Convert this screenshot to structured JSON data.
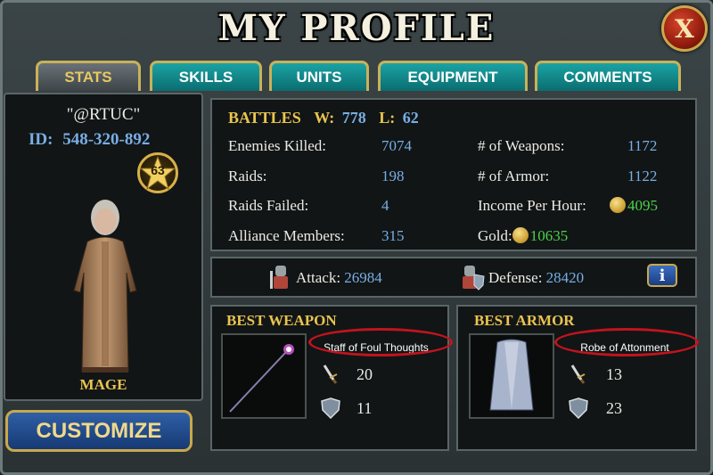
{
  "title": "MY PROFILE",
  "close_label": "X",
  "tabs": [
    {
      "label": "STATS",
      "active": true
    },
    {
      "label": "SKILLS",
      "active": false
    },
    {
      "label": "UNITS",
      "active": false
    },
    {
      "label": "EQUIPMENT",
      "active": false
    },
    {
      "label": "COMMENTS",
      "active": false
    }
  ],
  "profile": {
    "name": "\"@RTUC\"",
    "id_label": "ID:",
    "id_value": "548-320-892",
    "level": "63",
    "class_name": "MAGE",
    "customize_label": "CUSTOMIZE"
  },
  "battles": {
    "label": "BATTLES",
    "wins_label": "W:",
    "wins": "778",
    "losses_label": "L:",
    "losses": "62"
  },
  "stats_left": [
    {
      "label": "Enemies Killed:",
      "value": "7074"
    },
    {
      "label": "Raids:",
      "value": "198"
    },
    {
      "label": "Raids Failed:",
      "value": "4"
    },
    {
      "label": "Alliance Members:",
      "value": "315"
    }
  ],
  "stats_right": [
    {
      "label": "# of Weapons:",
      "value": "1172"
    },
    {
      "label": "# of Armor:",
      "value": "1122"
    },
    {
      "label": "Income Per Hour:",
      "value": "4095"
    },
    {
      "label": "Gold:",
      "value": "10635"
    }
  ],
  "combat": {
    "attack_label": "Attack:",
    "attack_value": "26984",
    "defense_label": "Defense:",
    "defense_value": "28420",
    "info_label": "i"
  },
  "best_weapon": {
    "header": "BEST WEAPON",
    "name": "Staff of Foul Thoughts",
    "attack": "20",
    "defense": "11"
  },
  "best_armor": {
    "header": "BEST ARMOR",
    "name": "Robe of Attonment",
    "attack": "13",
    "defense": "23"
  },
  "icons": {
    "close": "close-icon",
    "level": "star-icon",
    "coin": "gold-coin-icon",
    "attack": "attack-knight-icon",
    "defense": "defense-knight-icon",
    "sword": "sword-icon",
    "shield": "shield-icon",
    "info": "info-icon"
  },
  "colors": {
    "accent_gold": "#e9c44f",
    "value_blue": "#79aee3",
    "income_green": "#4ed14a",
    "tab_teal": "#1aa3a4",
    "highlight_red": "#c0141d"
  }
}
